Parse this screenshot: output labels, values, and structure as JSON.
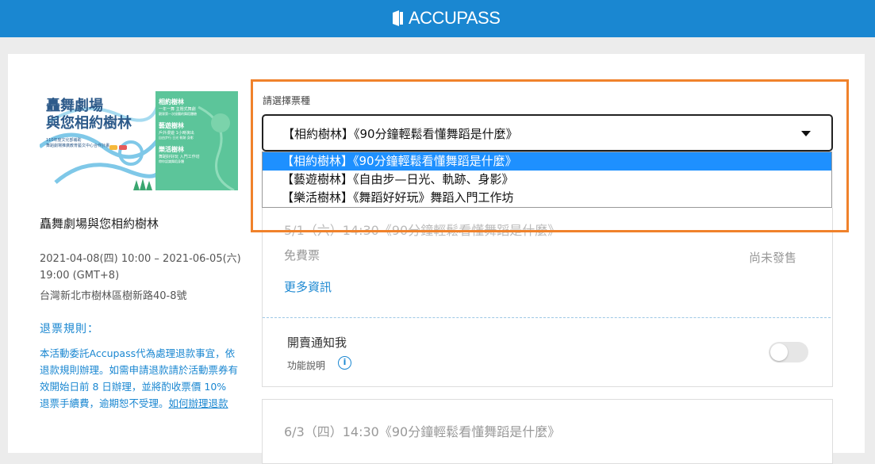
{
  "header": {
    "brand": "ACCUPASS"
  },
  "event": {
    "banner": {
      "title_line1": "矗舞劇場",
      "title_line2": "與您相約樹林",
      "sub1": "110年度文化部補助",
      "sub2": "舞蹈劇場推廣教育藝文中心合作計畫",
      "items": [
        {
          "name": "相約樹林",
          "desc": "一年一舞 主題式舞劇",
          "note": "觀眾第一次接觸的舞蹈體驗"
        },
        {
          "name": "藝遊樹林",
          "desc": "戶外漫遊 1小時演出",
          "note": "自由步行 日光 軌跡 身影"
        },
        {
          "name": "樂活樹林",
          "desc": "舞蹈好好玩 入門工作坊",
          "note": "帶你認識舞蹈身體"
        }
      ]
    },
    "title": "矗舞劇場與您相約樹林",
    "date": "2021-04-08(四) 10:00 – 2021-06-05(六) 19:00 (GMT+8)",
    "location": "台灣新北市樹林區樹新路40-8號",
    "refund": {
      "title": "退票規則：",
      "text": "本活動委託Accupass代為處理退款事宜，依退款規則辦理。如需申請退款請於活動票券有效開始日前 8 日辦理，並將酌收票價 10% 退票手續費，逾期恕不受理。",
      "link": "如何辦理退款"
    }
  },
  "ticket_select": {
    "label": "請選擇票種",
    "selected": "【相約樹林】《90分鐘輕鬆看懂舞蹈是什麼》",
    "options": [
      "【相約樹林】《90分鐘輕鬆看懂舞蹈是什麼》",
      "【藝遊樹林】《自由步—日光、軌跡、身影》",
      "【樂活樹林】《舞蹈好好玩》舞蹈入門工作坊"
    ]
  },
  "tickets": [
    {
      "session": "5/1（六）14:30《90分鐘輕鬆看懂舞蹈是什麼》",
      "name": "免費票",
      "status": "尚未發售",
      "more": "更多資訊"
    },
    {
      "session": "6/3（四）14:30《90分鐘輕鬆看懂舞蹈是什麼》"
    }
  ],
  "notify": {
    "label": "開賣通知我",
    "help": "功能說明",
    "enabled": false
  },
  "colors": {
    "brand_blue": "#1a87d1",
    "highlight": "#f0822b",
    "option_selected": "#1e90ff",
    "banner_green": "#5cc59a"
  }
}
